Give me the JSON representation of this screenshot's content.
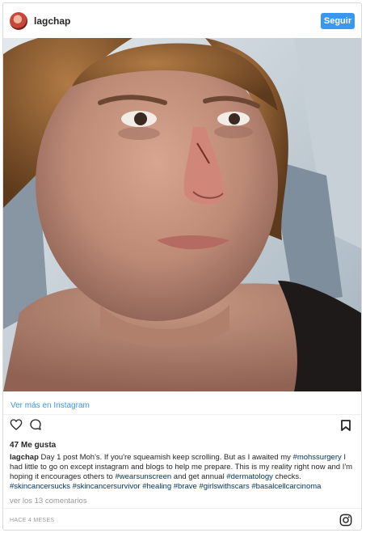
{
  "header": {
    "username": "lagchap",
    "follow_label": "Seguir"
  },
  "post": {
    "view_more": "Ver más en Instagram",
    "likes": "47 Me gusta",
    "caption_user": "lagchap",
    "caption_text_1": " Day 1 post Moh's. If you're squeamish keep scrolling. But as I awaited my ",
    "tag_1": "#mohssurgery",
    "caption_text_2": " I had little to go on except instagram and blogs to help me prepare. This is my reality right now and I'm hoping it encourages others to ",
    "tag_2": "#wearsunscreen",
    "caption_text_3": " and get annual ",
    "tag_3": "#dermatology",
    "caption_text_4": " checks. ",
    "tags_rest": "#skincancersucks #skincancersurvivor #healing #brave #girlswithscars #basalcellcarcinoma",
    "comments_link": "ver los 13 comentarios",
    "timestamp": "HACE 4 MESES"
  },
  "icons": {
    "avatar": "avatar",
    "like": "heart-icon",
    "comment": "comment-icon",
    "save": "bookmark-icon",
    "brand": "instagram-logo-icon"
  },
  "colors": {
    "accent": "#3897f0",
    "hashtag": "#003569",
    "muted": "#999999"
  }
}
